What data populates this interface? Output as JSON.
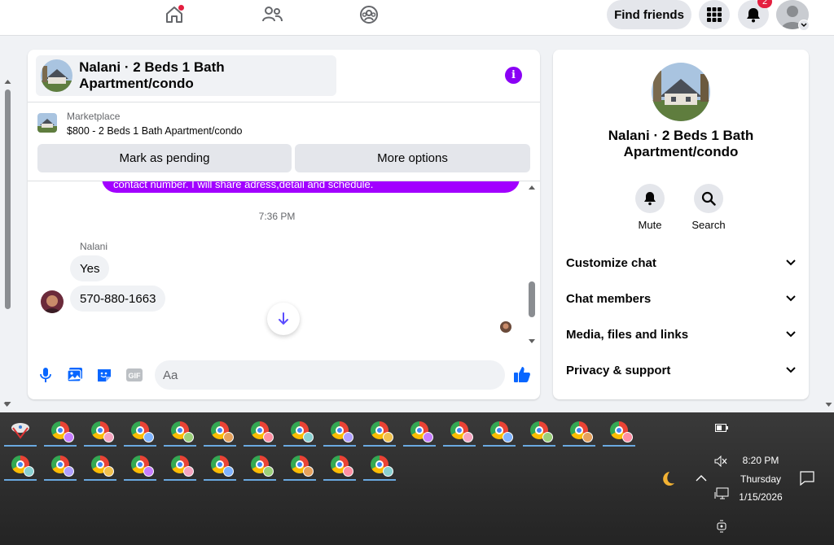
{
  "topnav": {
    "find_friends": "Find friends",
    "notification_count": "2",
    "icons": [
      "home-icon",
      "friends-icon",
      "groups-icon",
      "menu-grid-icon",
      "bell-icon"
    ]
  },
  "chat": {
    "title": "Nalani · 2 Beds 1 Bath Apartment/condo",
    "marketplace_label": "Marketplace",
    "listing": "$800 - 2 Beds 1 Bath Apartment/condo",
    "mark_pending": "Mark as pending",
    "more_options": "More options",
    "partial_message": "contact number. I will share adress,detail and schedule.",
    "timestamp": "7:36 PM",
    "sender": "Nalani",
    "messages": [
      "Yes",
      "570-880-1663"
    ],
    "input_placeholder": "Aa"
  },
  "info": {
    "title": "Nalani · 2 Beds 1 Bath Apartment/condo",
    "mute": "Mute",
    "search": "Search",
    "sections": [
      "Customize chat",
      "Chat members",
      "Media, files and links",
      "Privacy & support"
    ]
  },
  "taskbar": {
    "time": "8:20 PM",
    "day": "Thursday",
    "date": "1/15/2026"
  },
  "colors": {
    "accent": "#8a00f5",
    "bubble_purple": "#a200ff",
    "brand_blue": "#0866ff"
  }
}
